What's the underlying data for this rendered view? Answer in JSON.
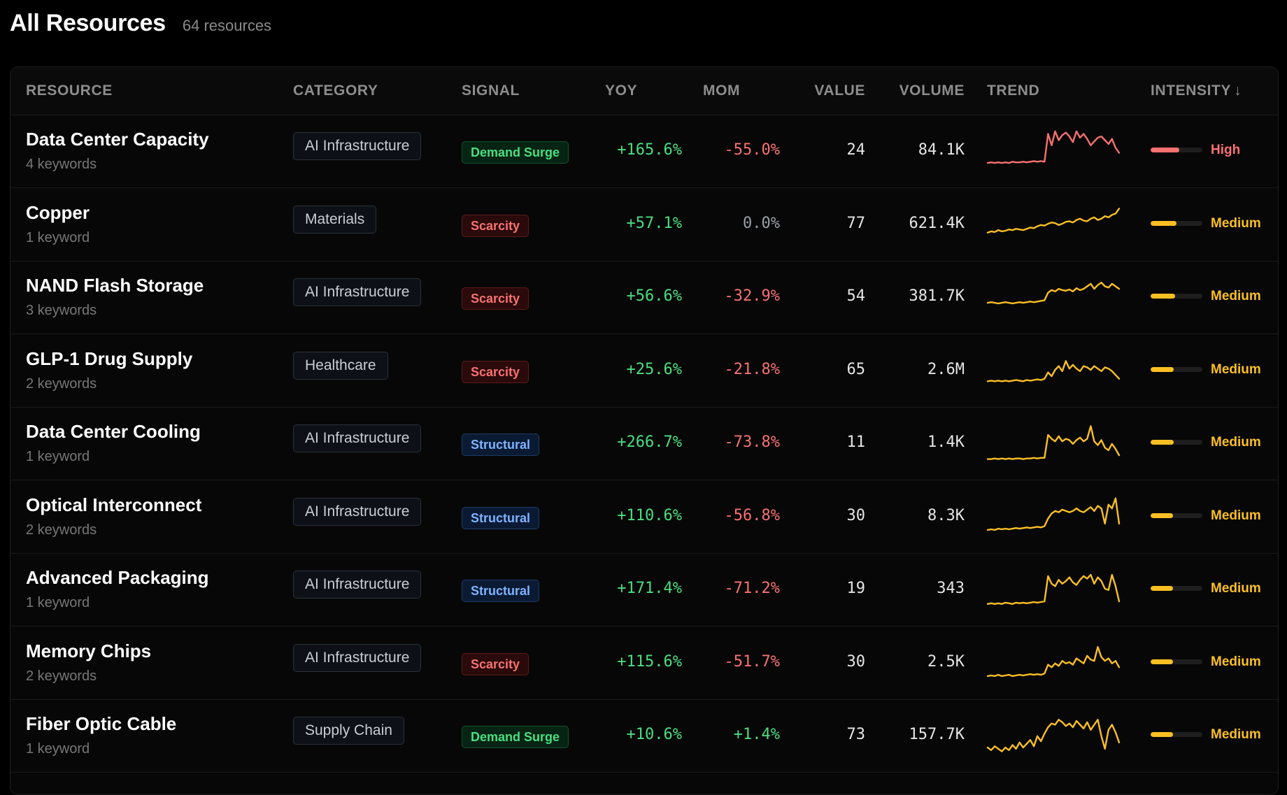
{
  "header": {
    "title": "All Resources",
    "count": "64 resources"
  },
  "columns": {
    "resource": "RESOURCE",
    "category": "CATEGORY",
    "signal": "SIGNAL",
    "yoy": "YOY",
    "mom": "MOM",
    "value": "VALUE",
    "volume": "VOLUME",
    "trend": "TREND",
    "intensity": "INTENSITY",
    "sort_arrow": "↓"
  },
  "colors": {
    "high": "#f87171",
    "medium": "#fbbf24",
    "positive": "#4ade80",
    "negative": "#f87171"
  },
  "rows": [
    {
      "name": "Data Center Capacity",
      "keywords": "4 keywords",
      "category": "AI Infrastructure",
      "signal": "Demand Surge",
      "signal_type": "demand",
      "yoy": "+165.6%",
      "mom": "-55.0%",
      "mom_type": "neg",
      "value": "24",
      "volume": "84.1K",
      "intensity": "High",
      "intensity_level": 0.55,
      "trend": [
        12,
        13,
        12,
        13,
        12,
        13,
        12,
        14,
        13,
        13,
        14,
        13,
        14,
        15,
        14,
        15,
        14,
        58,
        40,
        62,
        48,
        56,
        60,
        54,
        45,
        62,
        52,
        58,
        50,
        40,
        46,
        52,
        54,
        48,
        42,
        50,
        36,
        28
      ]
    },
    {
      "name": "Copper",
      "keywords": "1 keyword",
      "category": "Materials",
      "signal": "Scarcity",
      "signal_type": "scarcity",
      "yoy": "+57.1%",
      "mom": "0.0%",
      "mom_type": "zero",
      "value": "77",
      "volume": "621.4K",
      "intensity": "Medium",
      "intensity_level": 0.5,
      "trend": [
        18,
        20,
        19,
        22,
        20,
        21,
        23,
        22,
        24,
        23,
        22,
        24,
        26,
        25,
        28,
        30,
        29,
        32,
        34,
        33,
        30,
        32,
        35,
        36,
        34,
        38,
        40,
        37,
        36,
        40,
        42,
        38,
        40,
        44,
        42,
        46,
        48,
        56
      ]
    },
    {
      "name": "NAND Flash Storage",
      "keywords": "3 keywords",
      "category": "AI Infrastructure",
      "signal": "Scarcity",
      "signal_type": "scarcity",
      "yoy": "+56.6%",
      "mom": "-32.9%",
      "mom_type": "neg",
      "value": "54",
      "volume": "381.7K",
      "intensity": "Medium",
      "intensity_level": 0.47,
      "trend": [
        22,
        23,
        22,
        21,
        22,
        23,
        22,
        21,
        22,
        23,
        22,
        23,
        24,
        23,
        24,
        25,
        26,
        38,
        42,
        40,
        44,
        42,
        41,
        43,
        40,
        45,
        42,
        44,
        48,
        52,
        44,
        50,
        54,
        48,
        46,
        52,
        48,
        44
      ]
    },
    {
      "name": "GLP-1 Drug Supply",
      "keywords": "2 keywords",
      "category": "Healthcare",
      "signal": "Scarcity",
      "signal_type": "scarcity",
      "yoy": "+25.6%",
      "mom": "-21.8%",
      "mom_type": "neg",
      "value": "65",
      "volume": "2.6M",
      "intensity": "Medium",
      "intensity_level": 0.45,
      "trend": [
        14,
        15,
        14,
        15,
        14,
        15,
        14,
        15,
        16,
        15,
        14,
        16,
        15,
        16,
        17,
        16,
        18,
        28,
        22,
        32,
        38,
        30,
        46,
        34,
        40,
        34,
        30,
        38,
        36,
        32,
        38,
        34,
        30,
        36,
        34,
        30,
        24,
        18
      ]
    },
    {
      "name": "Data Center Cooling",
      "keywords": "1 keyword",
      "category": "AI Infrastructure",
      "signal": "Structural",
      "signal_type": "structural",
      "yoy": "+266.7%",
      "mom": "-73.8%",
      "mom_type": "neg",
      "value": "11",
      "volume": "1.4K",
      "intensity": "Medium",
      "intensity_level": 0.45,
      "trend": [
        6,
        6,
        7,
        6,
        7,
        6,
        7,
        6,
        7,
        7,
        6,
        7,
        7,
        8,
        7,
        8,
        8,
        44,
        38,
        34,
        42,
        34,
        38,
        36,
        30,
        36,
        40,
        34,
        38,
        58,
        34,
        28,
        36,
        24,
        20,
        30,
        22,
        12
      ]
    },
    {
      "name": "Optical Interconnect",
      "keywords": "2 keywords",
      "category": "AI Infrastructure",
      "signal": "Structural",
      "signal_type": "structural",
      "yoy": "+110.6%",
      "mom": "-56.8%",
      "mom_type": "neg",
      "value": "30",
      "volume": "8.3K",
      "intensity": "Medium",
      "intensity_level": 0.43,
      "trend": [
        10,
        11,
        10,
        12,
        11,
        12,
        11,
        12,
        13,
        12,
        13,
        14,
        13,
        14,
        15,
        14,
        16,
        28,
        36,
        40,
        38,
        42,
        40,
        38,
        40,
        44,
        40,
        38,
        42,
        46,
        40,
        48,
        44,
        20,
        50,
        44,
        60,
        20
      ]
    },
    {
      "name": "Advanced Packaging",
      "keywords": "1 keyword",
      "category": "AI Infrastructure",
      "signal": "Structural",
      "signal_type": "structural",
      "yoy": "+171.4%",
      "mom": "-71.2%",
      "mom_type": "neg",
      "value": "19",
      "volume": "343",
      "intensity": "Medium",
      "intensity_level": 0.43,
      "trend": [
        8,
        9,
        8,
        9,
        8,
        10,
        9,
        8,
        10,
        9,
        10,
        9,
        10,
        11,
        10,
        11,
        12,
        52,
        40,
        36,
        46,
        40,
        44,
        50,
        42,
        38,
        46,
        52,
        48,
        54,
        40,
        50,
        44,
        32,
        30,
        54,
        36,
        12
      ]
    },
    {
      "name": "Memory Chips",
      "keywords": "2 keywords",
      "category": "AI Infrastructure",
      "signal": "Scarcity",
      "signal_type": "scarcity",
      "yoy": "+115.6%",
      "mom": "-51.7%",
      "mom_type": "neg",
      "value": "30",
      "volume": "2.5K",
      "intensity": "Medium",
      "intensity_level": 0.43,
      "trend": [
        10,
        11,
        10,
        12,
        10,
        11,
        12,
        10,
        11,
        12,
        11,
        12,
        13,
        12,
        13,
        12,
        14,
        28,
        24,
        30,
        26,
        34,
        30,
        32,
        28,
        38,
        34,
        30,
        42,
        36,
        34,
        56,
        40,
        34,
        38,
        30,
        34,
        24
      ]
    },
    {
      "name": "Fiber Optic Cable",
      "keywords": "1 keyword",
      "category": "Supply Chain",
      "signal": "Demand Surge",
      "signal_type": "demand",
      "yoy": "+10.6%",
      "mom": "+1.4%",
      "mom_type": "pos",
      "value": "73",
      "volume": "157.7K",
      "intensity": "Medium",
      "intensity_level": 0.43,
      "trend": [
        12,
        8,
        14,
        10,
        6,
        12,
        8,
        16,
        10,
        20,
        12,
        18,
        24,
        14,
        30,
        22,
        34,
        44,
        50,
        48,
        56,
        52,
        46,
        50,
        44,
        54,
        48,
        42,
        52,
        40,
        48,
        56,
        30,
        10,
        40,
        48,
        36,
        20
      ]
    }
  ]
}
